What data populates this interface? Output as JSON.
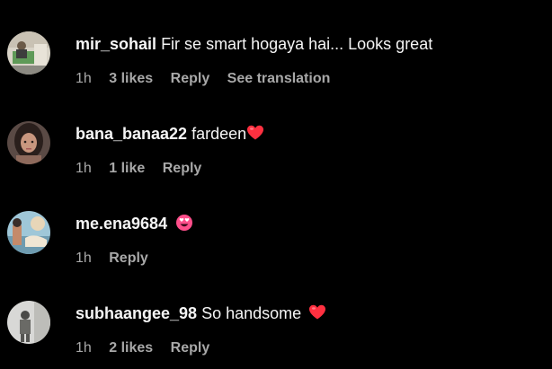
{
  "comments": [
    {
      "username": "mir_sohail",
      "text": "Fir se smart hogaya hai... Looks great",
      "emoji": "",
      "time": "1h",
      "likes": "3 likes",
      "reply": "Reply",
      "translation": "See translation"
    },
    {
      "username": "bana_banaa22",
      "text": "fardeen",
      "emoji": "red-heart-emoji",
      "time": "1h",
      "likes": "1 like",
      "reply": "Reply"
    },
    {
      "username": "me.ena9684",
      "text": "",
      "emoji": "heart-eyes-emoji",
      "time": "1h",
      "reply": "Reply"
    },
    {
      "username": "subhaangee_98",
      "text": "So handsome",
      "emoji": "red-heart-emoji",
      "time": "1h",
      "likes": "2 likes",
      "reply": "Reply"
    }
  ],
  "colors": {
    "background": "#000000",
    "primary_text": "#f5f5f5",
    "secondary_text": "#a8a8a8",
    "heart": "#ff3040"
  }
}
